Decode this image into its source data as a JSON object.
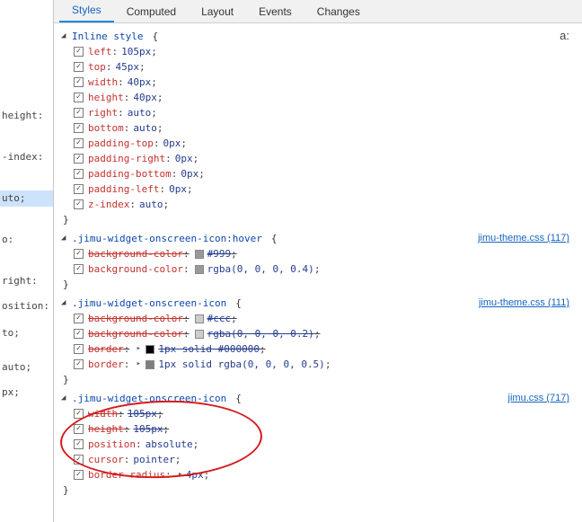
{
  "tabs": {
    "styles": "Styles",
    "computed": "Computed",
    "layout": "Layout",
    "events": "Events",
    "changes": "Changes"
  },
  "pseudo_label": "a:",
  "source_lines": {
    "l0": "height:",
    "l1": "-index:",
    "l2": "uto;",
    "l3": "o:",
    "l4": "right:",
    "l5": "osition:",
    "l6": "to;",
    "l7": " auto;",
    "l8": "px;"
  },
  "rules": [
    {
      "selector": "Inline style",
      "source": null,
      "decls": [
        {
          "prop": "left",
          "val": "105px",
          "struck": false
        },
        {
          "prop": "top",
          "val": "45px",
          "struck": false
        },
        {
          "prop": "width",
          "val": "40px",
          "struck": false
        },
        {
          "prop": "height",
          "val": "40px",
          "struck": false
        },
        {
          "prop": "right",
          "val": "auto",
          "struck": false
        },
        {
          "prop": "bottom",
          "val": "auto",
          "struck": false
        },
        {
          "prop": "padding-top",
          "val": "0px",
          "struck": false
        },
        {
          "prop": "padding-right",
          "val": "0px",
          "struck": false
        },
        {
          "prop": "padding-bottom",
          "val": "0px",
          "struck": false
        },
        {
          "prop": "padding-left",
          "val": "0px",
          "struck": false
        },
        {
          "prop": "z-index",
          "val": "auto",
          "struck": false
        }
      ]
    },
    {
      "selector": ".jimu-widget-onscreen-icon:hover",
      "source": "jimu-theme.css (117)",
      "decls": [
        {
          "prop": "background-color",
          "val": "#999",
          "struck": true,
          "swatch": "#999"
        },
        {
          "prop": "background-color",
          "val": "rgba(0, 0, 0, 0.4)",
          "struck": false,
          "swatch": "rgba(0,0,0,0.4)"
        }
      ]
    },
    {
      "selector": ".jimu-widget-onscreen-icon",
      "source": "jimu-theme.css (111)",
      "decls": [
        {
          "prop": "background-color",
          "val": "#ccc",
          "struck": true,
          "swatch": "#ccc"
        },
        {
          "prop": "background-color",
          "val": "rgba(0, 0, 0, 0.2)",
          "struck": true,
          "swatch": "rgba(0,0,0,0.2)"
        },
        {
          "prop": "border",
          "val": "1px solid #000000",
          "struck": true,
          "swatch": "#000000",
          "arrow": true
        },
        {
          "prop": "border",
          "val": "1px solid rgba(0, 0, 0, 0.5)",
          "struck": false,
          "swatch": "rgba(0,0,0,0.5)",
          "arrow": true
        }
      ]
    },
    {
      "selector": ".jimu-widget-onscreen-icon",
      "source": "jimu.css (717)",
      "decls": [
        {
          "prop": "width",
          "val": "105px",
          "struck": true
        },
        {
          "prop": "height",
          "val": "105px",
          "struck": true
        },
        {
          "prop": "position",
          "val": "absolute",
          "struck": false
        },
        {
          "prop": "cursor",
          "val": "pointer",
          "struck": false
        },
        {
          "prop": "border-radius",
          "val": "4px",
          "struck": false,
          "arrow": true
        }
      ]
    }
  ]
}
